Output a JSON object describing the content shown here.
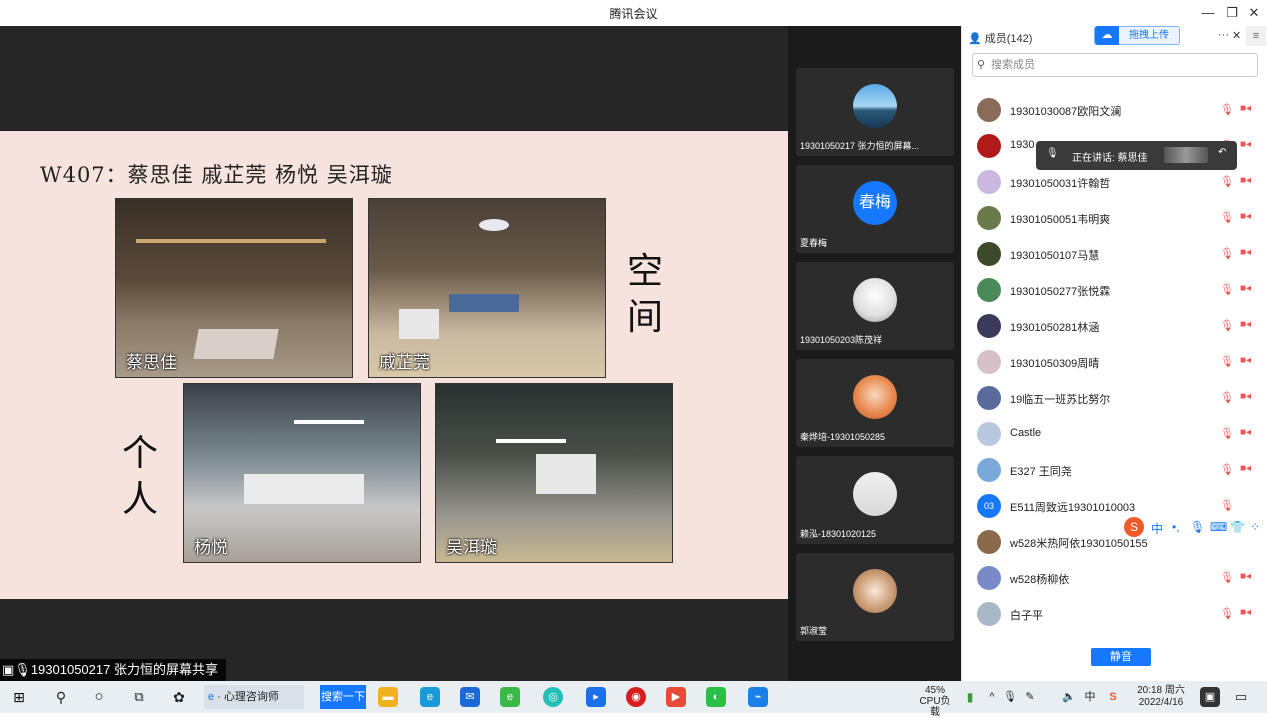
{
  "window": {
    "title": "腾讯会议"
  },
  "share": {
    "slide_title": "W407：蔡思佳 戚芷莞 杨悦 吴洱璇",
    "captions": [
      "蔡思佳",
      "戚芷莞",
      "杨悦",
      "吴洱璇"
    ],
    "vertical_space": "空间",
    "vertical_personal": "个人",
    "label": "19301050217 张力恒的屏幕共享"
  },
  "tiles": [
    {
      "name": "19301050217 张力恒的屏幕...",
      "avatar": "landscape"
    },
    {
      "name": "夏春梅",
      "avatar_text": "春梅"
    },
    {
      "name": "19301050203陈茂祥",
      "avatar": "silhouette"
    },
    {
      "name": "秦烨培-19301050285",
      "avatar": "anime"
    },
    {
      "name": "赖泓-18301020125",
      "avatar": "paper"
    },
    {
      "name": "郭淑莹",
      "avatar": "cat"
    }
  ],
  "panel": {
    "members_label": "成员(142)",
    "upload_label": "拖拽上传",
    "search_placeholder": "搜索成员",
    "speaking_label": "正在讲话: 蔡思佳",
    "mute_label": "静音",
    "members": [
      {
        "name": "19301030087欧阳文澜",
        "color": "#8a6b5a"
      },
      {
        "name": "1930",
        "color": "#b11a1a"
      },
      {
        "name": "19301050031许翰哲",
        "color": "#c9b8e0"
      },
      {
        "name": "19301050051韦明爽",
        "color": "#6b7a4a"
      },
      {
        "name": "19301050107马慧",
        "color": "#3a4a2a"
      },
      {
        "name": "19301050277张悦霖",
        "color": "#4a8a5a"
      },
      {
        "name": "19301050281林涵",
        "color": "#3a3a5a"
      },
      {
        "name": "19301050309周晴",
        "color": "#d8c0c8"
      },
      {
        "name": "19临五一班苏比努尔",
        "color": "#5a6a9a"
      },
      {
        "name": "Castle",
        "color": "#b8c8e0"
      },
      {
        "name": "E327 王同尧",
        "color": "#7aa8d8"
      },
      {
        "name": "E511周致远19301010003",
        "avatar_text": "03",
        "color": "#1677ff"
      },
      {
        "name": "w528米热阿依19301050155",
        "color": "#8a6a4a"
      },
      {
        "name": "w528杨柳依",
        "color": "#7a8ac8"
      },
      {
        "name": "白子平",
        "color": "#a8b8c8"
      }
    ]
  },
  "ime": {
    "label": "中"
  },
  "taskbar": {
    "search_label": "搜索一下",
    "browser_tab": "心理咨询师",
    "cpu": "45%",
    "cpu_label": "CPU负载",
    "time": "20:18 周六",
    "date": "2022/4/16",
    "ime_cn": "中"
  }
}
